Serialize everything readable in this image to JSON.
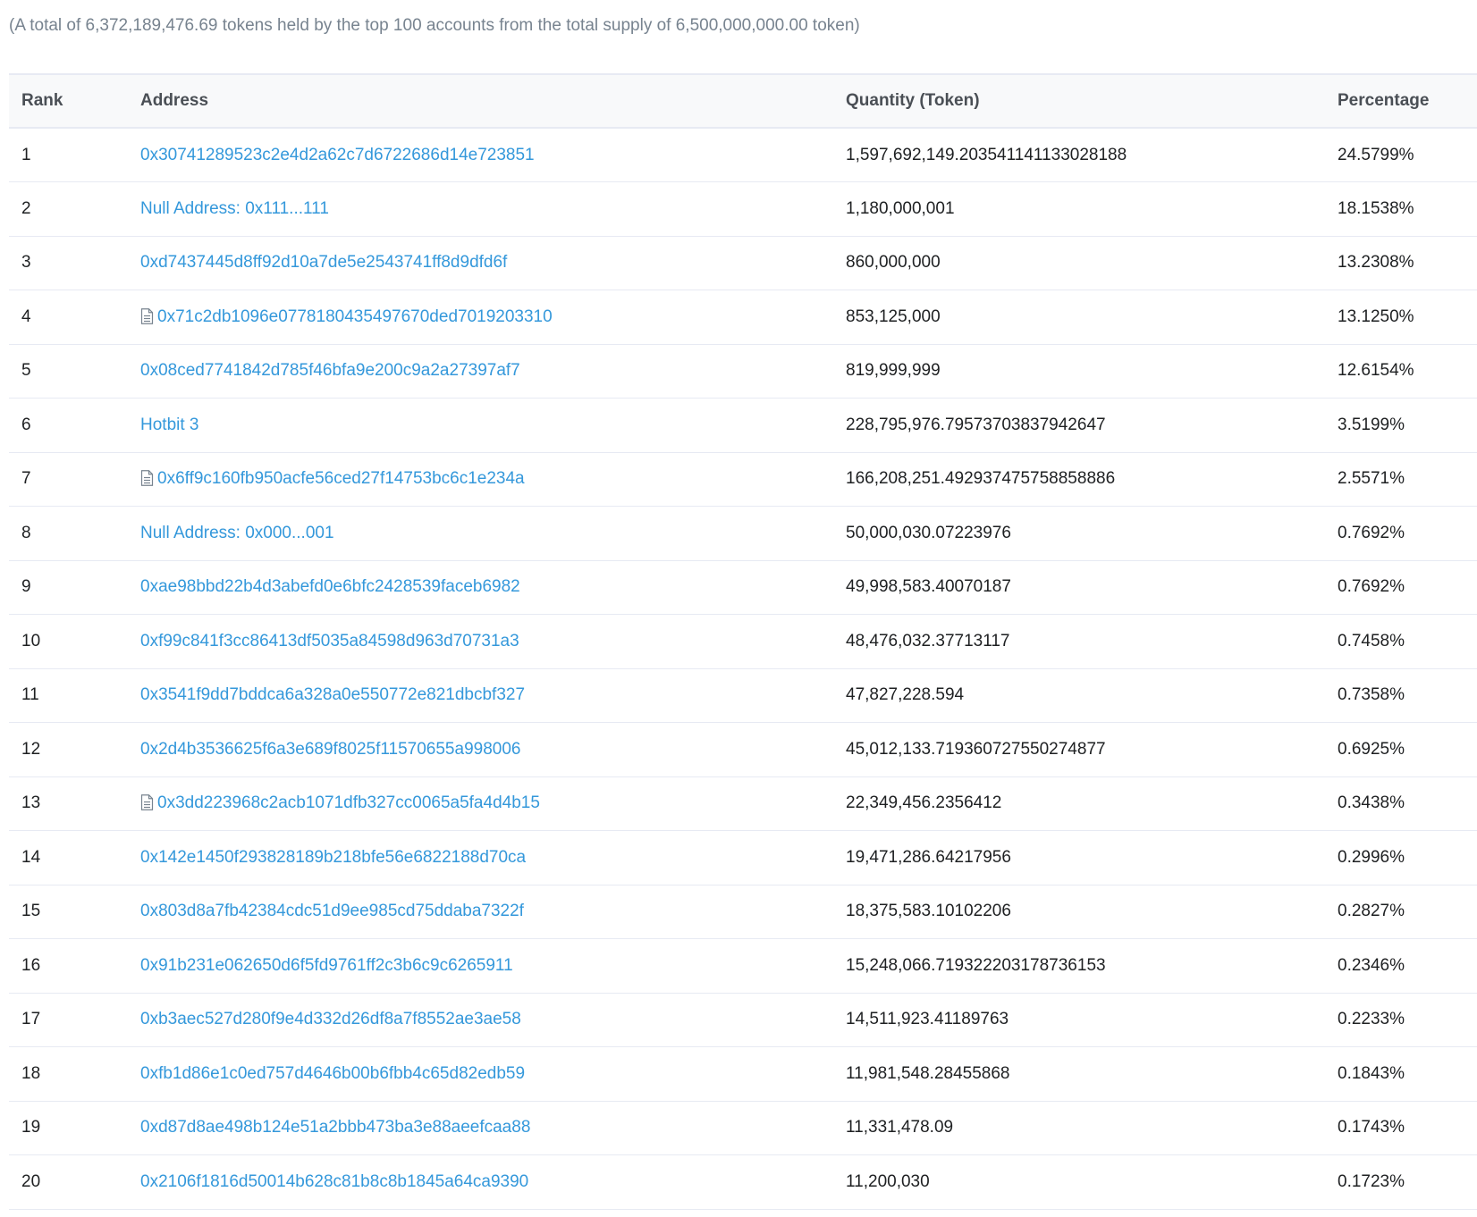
{
  "summary": "(A total of 6,372,189,476.69 tokens held by the top 100 accounts from the total supply of 6,500,000,000.00 token)",
  "columns": {
    "rank": "Rank",
    "address": "Address",
    "quantity": "Quantity (Token)",
    "percentage": "Percentage"
  },
  "rows": [
    {
      "rank": "1",
      "address": "0x30741289523c2e4d2a62c7d6722686d14e723851",
      "contract": false,
      "quantity": "1,597,692,149.203541141133028188",
      "percentage": "24.5799%"
    },
    {
      "rank": "2",
      "address": "Null Address: 0x111...111",
      "contract": false,
      "quantity": "1,180,000,001",
      "percentage": "18.1538%"
    },
    {
      "rank": "3",
      "address": "0xd7437445d8ff92d10a7de5e2543741ff8d9dfd6f",
      "contract": false,
      "quantity": "860,000,000",
      "percentage": "13.2308%"
    },
    {
      "rank": "4",
      "address": "0x71c2db1096e0778180435497670ded7019203310",
      "contract": true,
      "quantity": "853,125,000",
      "percentage": "13.1250%"
    },
    {
      "rank": "5",
      "address": "0x08ced7741842d785f46bfa9e200c9a2a27397af7",
      "contract": false,
      "quantity": "819,999,999",
      "percentage": "12.6154%"
    },
    {
      "rank": "6",
      "address": "Hotbit 3",
      "contract": false,
      "quantity": "228,795,976.79573703837942647",
      "percentage": "3.5199%"
    },
    {
      "rank": "7",
      "address": "0x6ff9c160fb950acfe56ced27f14753bc6c1e234a",
      "contract": true,
      "quantity": "166,208,251.492937475758858886",
      "percentage": "2.5571%"
    },
    {
      "rank": "8",
      "address": "Null Address: 0x000...001",
      "contract": false,
      "quantity": "50,000,030.07223976",
      "percentage": "0.7692%"
    },
    {
      "rank": "9",
      "address": "0xae98bbd22b4d3abefd0e6bfc2428539faceb6982",
      "contract": false,
      "quantity": "49,998,583.40070187",
      "percentage": "0.7692%"
    },
    {
      "rank": "10",
      "address": "0xf99c841f3cc86413df5035a84598d963d70731a3",
      "contract": false,
      "quantity": "48,476,032.37713117",
      "percentage": "0.7458%"
    },
    {
      "rank": "11",
      "address": "0x3541f9dd7bddca6a328a0e550772e821dbcbf327",
      "contract": false,
      "quantity": "47,827,228.594",
      "percentage": "0.7358%"
    },
    {
      "rank": "12",
      "address": "0x2d4b3536625f6a3e689f8025f11570655a998006",
      "contract": false,
      "quantity": "45,012,133.719360727550274877",
      "percentage": "0.6925%"
    },
    {
      "rank": "13",
      "address": "0x3dd223968c2acb1071dfb327cc0065a5fa4d4b15",
      "contract": true,
      "quantity": "22,349,456.2356412",
      "percentage": "0.3438%"
    },
    {
      "rank": "14",
      "address": "0x142e1450f293828189b218bfe56e6822188d70ca",
      "contract": false,
      "quantity": "19,471,286.64217956",
      "percentage": "0.2996%"
    },
    {
      "rank": "15",
      "address": "0x803d8a7fb42384cdc51d9ee985cd75ddaba7322f",
      "contract": false,
      "quantity": "18,375,583.10102206",
      "percentage": "0.2827%"
    },
    {
      "rank": "16",
      "address": "0x91b231e062650d6f5fd9761ff2c3b6c9c6265911",
      "contract": false,
      "quantity": "15,248,066.719322203178736153",
      "percentage": "0.2346%"
    },
    {
      "rank": "17",
      "address": "0xb3aec527d280f9e4d332d26df8a7f8552ae3ae58",
      "contract": false,
      "quantity": "14,511,923.41189763",
      "percentage": "0.2233%"
    },
    {
      "rank": "18",
      "address": "0xfb1d86e1c0ed757d4646b00b6fbb4c65d82edb59",
      "contract": false,
      "quantity": "11,981,548.28455868",
      "percentage": "0.1843%"
    },
    {
      "rank": "19",
      "address": "0xd87d8ae498b124e51a2bbb473ba3e88aeefcaa88",
      "contract": false,
      "quantity": "11,331,478.09",
      "percentage": "0.1743%"
    },
    {
      "rank": "20",
      "address": "0x2106f1816d50014b628c81b8c8b1845a64ca9390",
      "contract": false,
      "quantity": "11,200,030",
      "percentage": "0.1723%"
    }
  ]
}
